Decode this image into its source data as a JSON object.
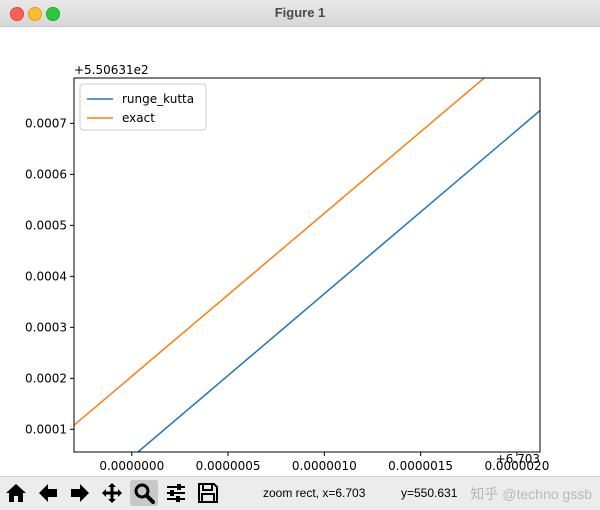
{
  "window": {
    "title": "Figure 1"
  },
  "chart_data": {
    "type": "line",
    "x_offset_label": "+6.703",
    "y_offset_label": "+5.50631e2",
    "xlim": [
      -3e-07,
      2.12e-06
    ],
    "ylim": [
      5.55e-05,
      0.000789
    ],
    "x_ticks": [
      0.0,
      5e-07,
      1e-06,
      1.5e-06,
      2e-06
    ],
    "x_tick_labels": [
      "0.0000000",
      "0.0000005",
      "0.0000010",
      "0.0000015",
      "0.0000020"
    ],
    "y_ticks": [
      0.0001,
      0.0002,
      0.0003,
      0.0004,
      0.0005,
      0.0006,
      0.0007
    ],
    "y_tick_labels": [
      "0.0001",
      "0.0002",
      "0.0003",
      "0.0004",
      "0.0005",
      "0.0006",
      "0.0007"
    ],
    "legend_position": "upper-left",
    "grid": false,
    "series": [
      {
        "name": "runge_kutta",
        "color": "#1f77b4",
        "x": [
          3.21e-08,
          2.12e-06
        ],
        "y": [
          5.55e-05,
          0.000725
        ]
      },
      {
        "name": "exact",
        "color": "#ff7f0e",
        "x": [
          -3e-07,
          1.83e-06
        ],
        "y": [
          0.000108,
          0.000789
        ]
      }
    ]
  },
  "toolbar": {
    "buttons": [
      {
        "name": "home-button",
        "icon": "home-icon"
      },
      {
        "name": "back-button",
        "icon": "arrow-left-icon"
      },
      {
        "name": "forward-button",
        "icon": "arrow-right-icon"
      },
      {
        "name": "pan-button",
        "icon": "move-icon"
      },
      {
        "name": "zoom-button",
        "icon": "magnifier-icon",
        "active": true
      },
      {
        "name": "configure-subplots-button",
        "icon": "sliders-icon"
      },
      {
        "name": "save-button",
        "icon": "floppy-icon"
      }
    ]
  },
  "status": {
    "mode_x": "zoom rect, x=6.703",
    "y": "y=550.631"
  },
  "watermark": "知乎 @techno gssb"
}
